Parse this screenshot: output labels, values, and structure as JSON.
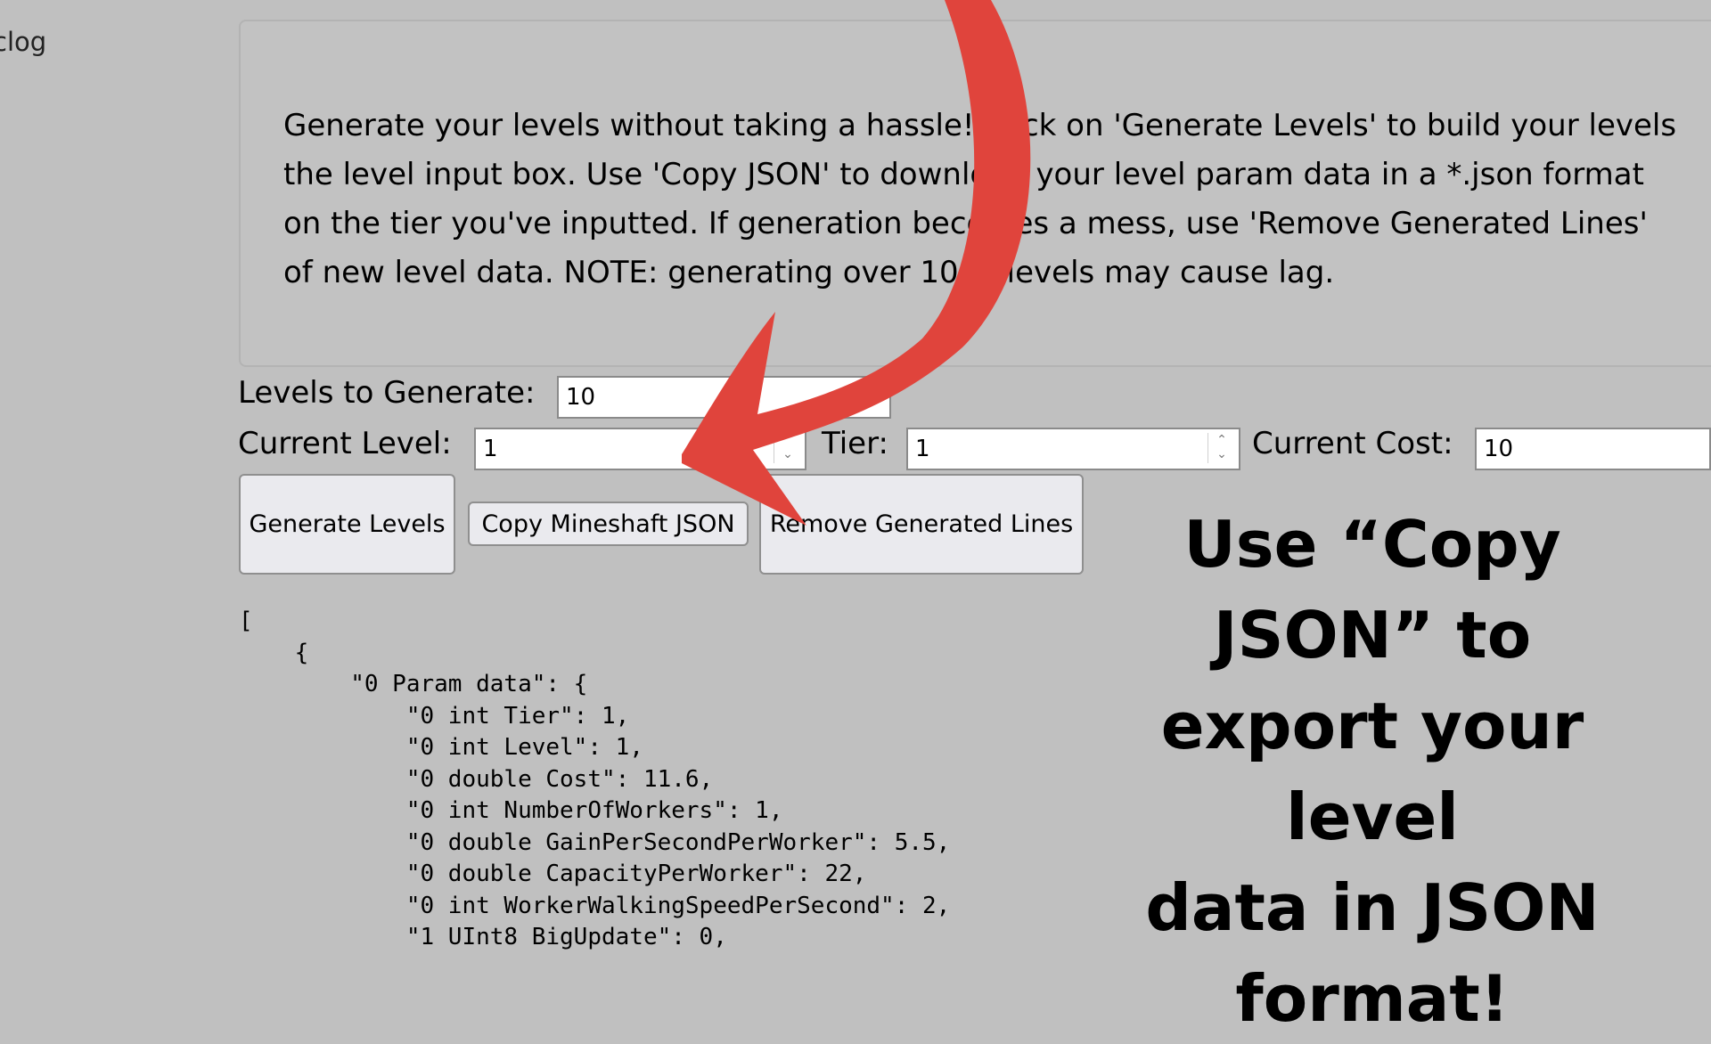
{
  "sidebar": {
    "partial_label": "clog"
  },
  "description": {
    "lines": [
      "Generate your levels without taking a hassle! Click on 'Generate Levels' to build your levels",
      "the level input box. Use 'Copy JSON' to download your level param data in a *.json format",
      "on the tier you've inputted. If generation becomes a mess, use 'Remove Generated Lines'",
      "of new level data. NOTE: generating over 1000 levels may cause lag."
    ]
  },
  "form": {
    "levels_to_generate": {
      "label": "Levels to Generate:",
      "value": "10"
    },
    "current_level": {
      "label": "Current Level:",
      "value": "1"
    },
    "tier": {
      "label": "Tier:",
      "value": "1"
    },
    "current_cost": {
      "label": "Current Cost:",
      "value": "10"
    }
  },
  "buttons": {
    "generate": "Generate Levels",
    "copy_json": "Copy Mineshaft JSON",
    "remove": "Remove Generated Lines"
  },
  "json_output": [
    "[",
    "    {",
    "        \"0 Param data\": {",
    "            \"0 int Tier\": 1,",
    "            \"0 int Level\": 1,",
    "            \"0 double Cost\": 11.6,",
    "            \"0 int NumberOfWorkers\": 1,",
    "            \"0 double GainPerSecondPerWorker\": 5.5,",
    "            \"0 double CapacityPerWorker\": 22,",
    "            \"0 int WorkerWalkingSpeedPerSecond\": 2,",
    "            \"1 UInt8 BigUpdate\": 0,"
  ],
  "annotation": {
    "lines": [
      "Use “Copy",
      "JSON” to",
      "export your level",
      "data in JSON",
      "format!"
    ]
  },
  "colors": {
    "background": "#c0c0c0",
    "arrow": "#e0443c"
  }
}
